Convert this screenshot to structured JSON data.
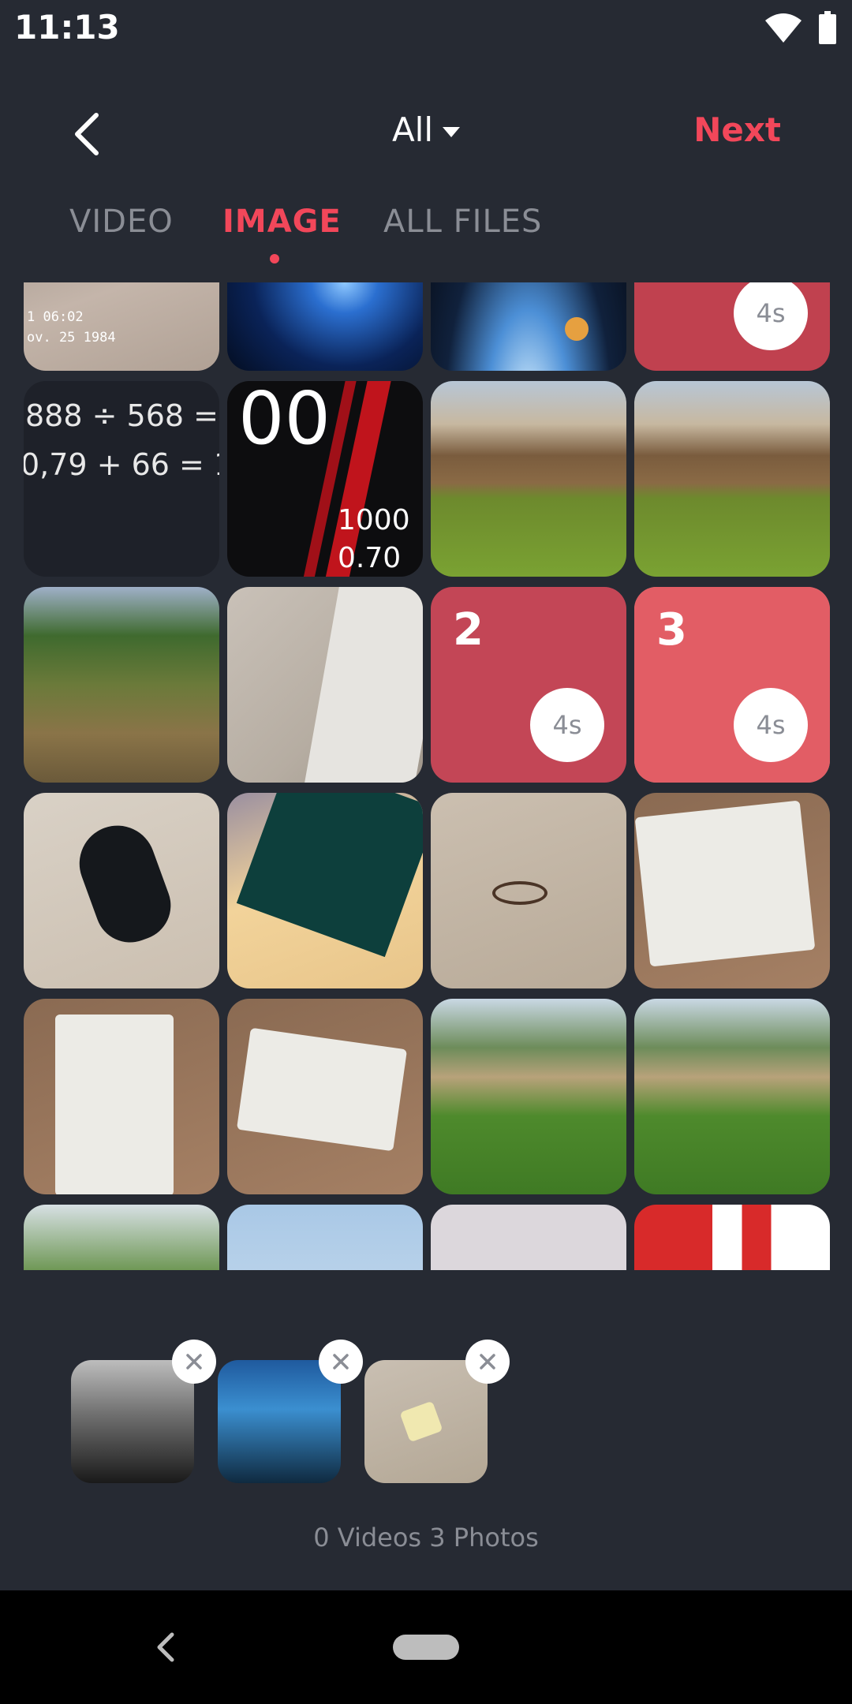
{
  "status_bar": {
    "time": "11:13"
  },
  "header": {
    "album": "All",
    "next_label": "Next"
  },
  "tabs": [
    {
      "label": "VIDEO"
    },
    {
      "label": "IMAGE"
    },
    {
      "label": "ALL FILES"
    }
  ],
  "active_tab": "IMAGE",
  "grid": {
    "row1": [
      {
        "name": "keyboard-photo",
        "caption_1": "1 06:02",
        "caption_2": "ov. 25 1984"
      },
      {
        "name": "galaxy-photo"
      },
      {
        "name": "planet-photo"
      },
      {
        "name": "concert-video",
        "duration": "4s",
        "selected": true
      }
    ],
    "row2": [
      {
        "name": "calculator-screenshot",
        "line_1": "888 ÷ 568 =",
        "line_2": "0,79 + 66 = 1"
      },
      {
        "name": "watch-face-photo",
        "big": "00",
        "val_1": "1000",
        "val_2": "0.70"
      },
      {
        "name": "garden-fence-photo-1"
      },
      {
        "name": "garden-fence-photo-2"
      }
    ],
    "row3": [
      {
        "name": "hillside-photo"
      },
      {
        "name": "drawer-photo"
      },
      {
        "name": "phone-video",
        "order": "2",
        "duration": "4s",
        "selected": true
      },
      {
        "name": "object-video",
        "order": "3",
        "duration": "4s",
        "selected": true
      }
    ],
    "row4": [
      {
        "name": "mouse-photo"
      },
      {
        "name": "ariston-manual-photo"
      },
      {
        "name": "cable-photo"
      },
      {
        "name": "receipt-photo-1"
      }
    ],
    "row5": [
      {
        "name": "receipt-photo-2"
      },
      {
        "name": "receipt-photo-3"
      },
      {
        "name": "forest-photo-1"
      },
      {
        "name": "forest-photo-2"
      }
    ],
    "row6": [
      {
        "name": "trees-photo"
      },
      {
        "name": "sky-photo"
      },
      {
        "name": "white-photo"
      },
      {
        "name": "red-pattern-photo"
      }
    ]
  },
  "tray": [
    {
      "name": "concert-thumb"
    },
    {
      "name": "phone-thumb"
    },
    {
      "name": "object-thumb"
    }
  ],
  "counter": "0 Videos 3 Photos",
  "colors": {
    "accent": "#f2475a",
    "background": "#262a33",
    "muted": "#8a8d95"
  }
}
